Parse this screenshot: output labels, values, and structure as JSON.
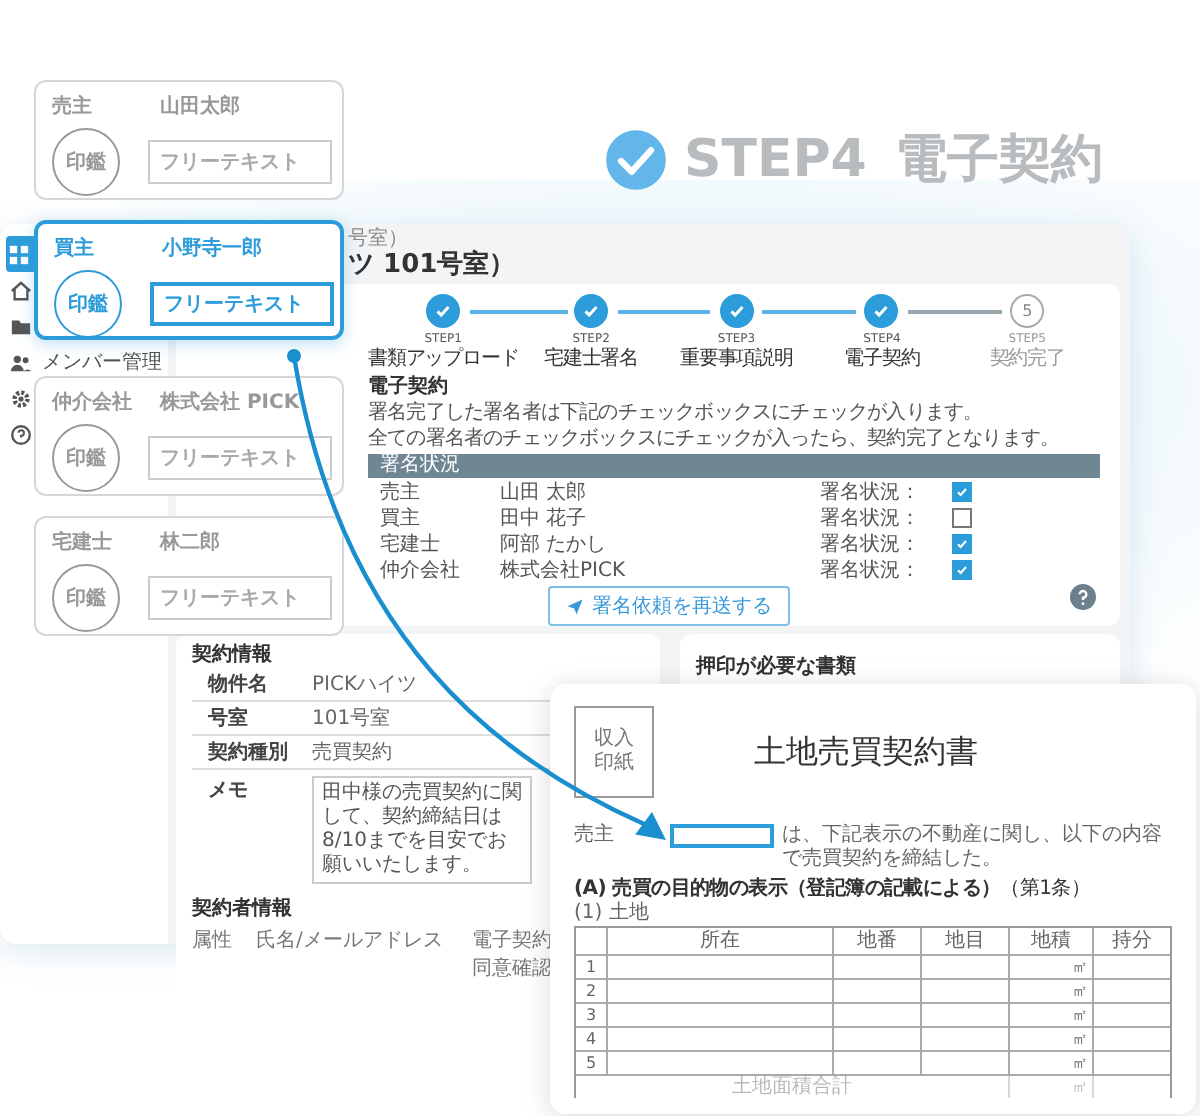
{
  "headline": {
    "step": "STEP4",
    "title": "電子契約"
  },
  "signer_cards": [
    {
      "role": "売主",
      "name": "山田太郎",
      "seal": "印鑑",
      "placeholder": "フリーテキスト",
      "selected": false
    },
    {
      "role": "買主",
      "name": "小野寺一郎",
      "seal": "印鑑",
      "placeholder": "フリーテキスト",
      "selected": true
    },
    {
      "role": "仲介会社",
      "name": "株式会社 PICK",
      "seal": "印鑑",
      "placeholder": "フリーテキスト",
      "selected": false
    },
    {
      "role": "宅建士",
      "name": "林二郎",
      "seal": "印鑑",
      "placeholder": "フリーテキスト",
      "selected": false
    }
  ],
  "sidebar": {
    "items": [
      {
        "kind": "dashboard",
        "selected": true
      },
      {
        "kind": "home",
        "selected": false
      },
      {
        "kind": "folder",
        "selected": false
      },
      {
        "kind": "members",
        "label": "メンバー管理",
        "selected": false
      },
      {
        "kind": "gear",
        "selected": false
      },
      {
        "kind": "help",
        "selected": false
      }
    ]
  },
  "page": {
    "breadcrumb": "号室）",
    "title": "ツ 101号室）"
  },
  "steps": [
    {
      "top": "STEP1",
      "label": "書類アップロード",
      "done": true
    },
    {
      "top": "STEP2",
      "label": "宅建士署名",
      "done": true
    },
    {
      "top": "STEP3",
      "label": "重要事項説明",
      "done": true
    },
    {
      "top": "STEP4",
      "label": "電子契約",
      "done": true
    },
    {
      "top": "STEP5",
      "label": "契約完了",
      "done": false,
      "number": "5"
    }
  ],
  "signing": {
    "heading": "電子契約",
    "lines": [
      "署名完了した署名者は下記のチェックボックスにチェックが入ります。",
      "全ての署名者のチェックボックスにチェックが入ったら、契約完了となります。"
    ],
    "table_header": "署名状況",
    "rows": [
      {
        "role": "売主",
        "name": "山田 太郎",
        "status_label": "署名状況：",
        "checked": true
      },
      {
        "role": "買主",
        "name": "田中 花子",
        "status_label": "署名状況：",
        "checked": false
      },
      {
        "role": "宅建士",
        "name": "阿部 たかし",
        "status_label": "署名状況：",
        "checked": true
      },
      {
        "role": "仲介会社",
        "name": "株式会社PICK",
        "status_label": "署名状況：",
        "checked": true
      }
    ],
    "resend_button": "署名依頼を再送する"
  },
  "contract_info": {
    "heading": "契約情報",
    "fields": [
      {
        "label": "物件名",
        "value": "PICKハイツ"
      },
      {
        "label": "号室",
        "value": "101号室"
      },
      {
        "label": "契約種別",
        "value": "売買契約"
      }
    ],
    "memo_label": "メモ",
    "memo": "田中様の売買契約に関して、契約締結日は8/10までを目安でお願いいたします。"
  },
  "parties": {
    "heading": "契約者情報",
    "columns": [
      "属性",
      "氏名/メールアドレス",
      "電子契約同意確認"
    ]
  },
  "seal_documents": {
    "heading": "押印が必要な書類"
  },
  "document": {
    "stamp": "収入印紙",
    "title": "土地売買契約書",
    "prefix": "売主",
    "suffix": "は、下記表示の不動産に関し、以下の内容で売買契約を締結した。",
    "section": "**(A) 売買の目的物の表示（登記簿の記載による）**（第1条）",
    "subsection": "(1) 土地",
    "columns": [
      "所在",
      "地番",
      "地目",
      "地積",
      "持分"
    ],
    "rows": [
      {
        "number": "1",
        "unit": "㎡"
      },
      {
        "number": "2",
        "unit": "㎡"
      },
      {
        "number": "3",
        "unit": "㎡"
      },
      {
        "number": "4",
        "unit": "㎡"
      },
      {
        "number": "5",
        "unit": "㎡"
      }
    ],
    "total_label": "土地面積合計",
    "total_unit": "㎡"
  }
}
